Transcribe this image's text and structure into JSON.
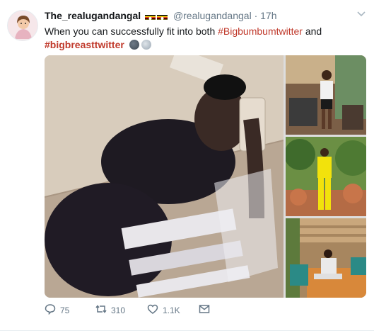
{
  "tweet": {
    "display_name": "The_realugandangal",
    "flags": [
      "uganda-flag",
      "uganda-flag"
    ],
    "handle": "@realugandangal",
    "separator": "·",
    "timestamp": "17h",
    "text_before": "When you can successfully fit into both ",
    "hashtag_1": "#Bigbumbumtwitter",
    "text_and": " and",
    "hashtag_2": "#bigbreasttwitter",
    "emojis": [
      "new-moon-face-emoji",
      "smiling-moon-emoji"
    ],
    "more_icon": "chevron-down-icon"
  },
  "actions": {
    "reply_count": "75",
    "retweet_count": "310",
    "like_count": "1.1K",
    "reply_icon": "reply-icon",
    "retweet_icon": "retweet-icon",
    "like_icon": "heart-icon",
    "dm_icon": "envelope-icon"
  },
  "colors": {
    "hashtag": "#c0392b",
    "meta": "#657786",
    "text": "#14171a"
  }
}
